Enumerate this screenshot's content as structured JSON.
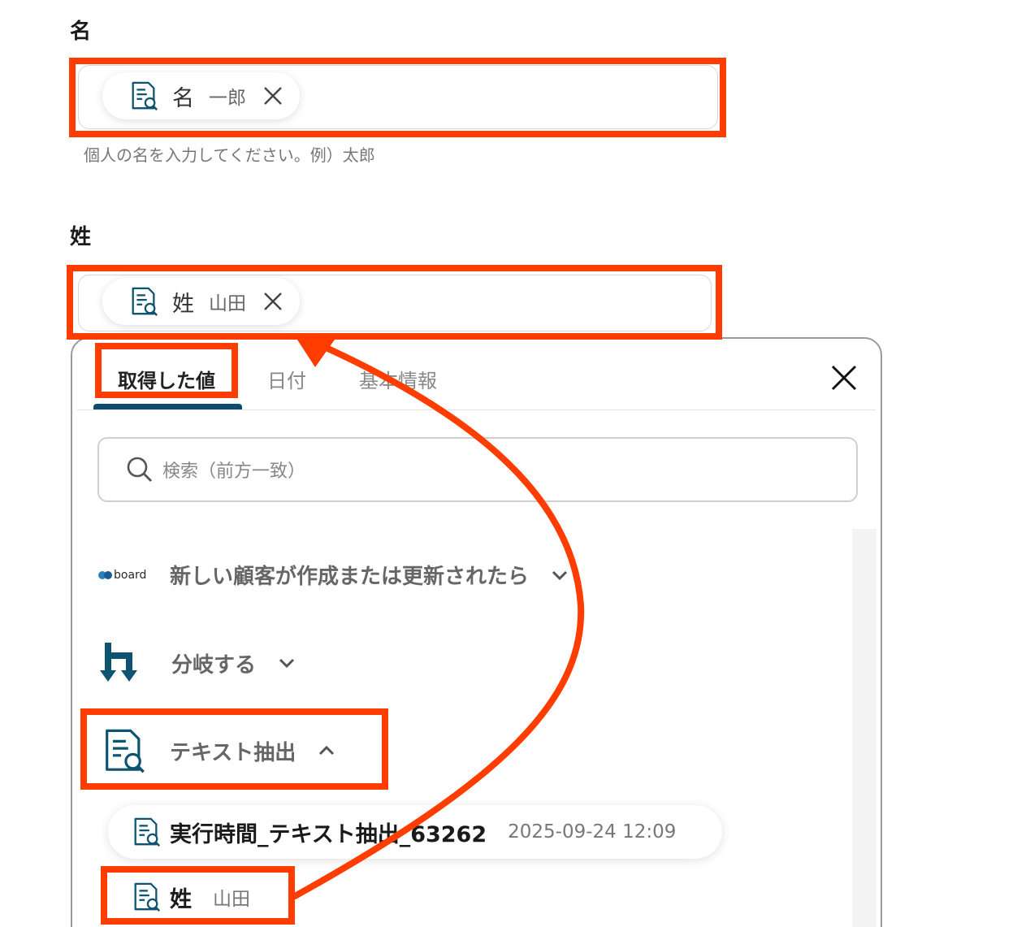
{
  "form": {
    "first_name": {
      "label": "名",
      "token_key": "名",
      "token_value": "一郎",
      "hint": "個人の名を入力してください。例）太郎"
    },
    "last_name": {
      "label": "姓",
      "token_key": "姓",
      "token_value": "山田"
    }
  },
  "popup": {
    "tabs": [
      {
        "label": "取得した値",
        "active": true
      },
      {
        "label": "日付",
        "active": false
      },
      {
        "label": "基本情報",
        "active": false
      }
    ],
    "search_placeholder": "検索（前方一致）",
    "sections": [
      {
        "logo_text": "board",
        "title": "新しい顧客が作成または更新されたら",
        "expanded": false
      },
      {
        "title": "分岐する",
        "expanded": false
      },
      {
        "title": "テキスト抽出",
        "expanded": true
      }
    ],
    "results": [
      {
        "key": "実行時間_テキスト抽出_63262",
        "value": "2025-09-24 12:09"
      },
      {
        "key": "姓",
        "value": "山田"
      }
    ]
  },
  "colors": {
    "highlight": "#ff3d00",
    "icon_teal": "#0d5470",
    "tab_underline": "#0d4a6e"
  }
}
